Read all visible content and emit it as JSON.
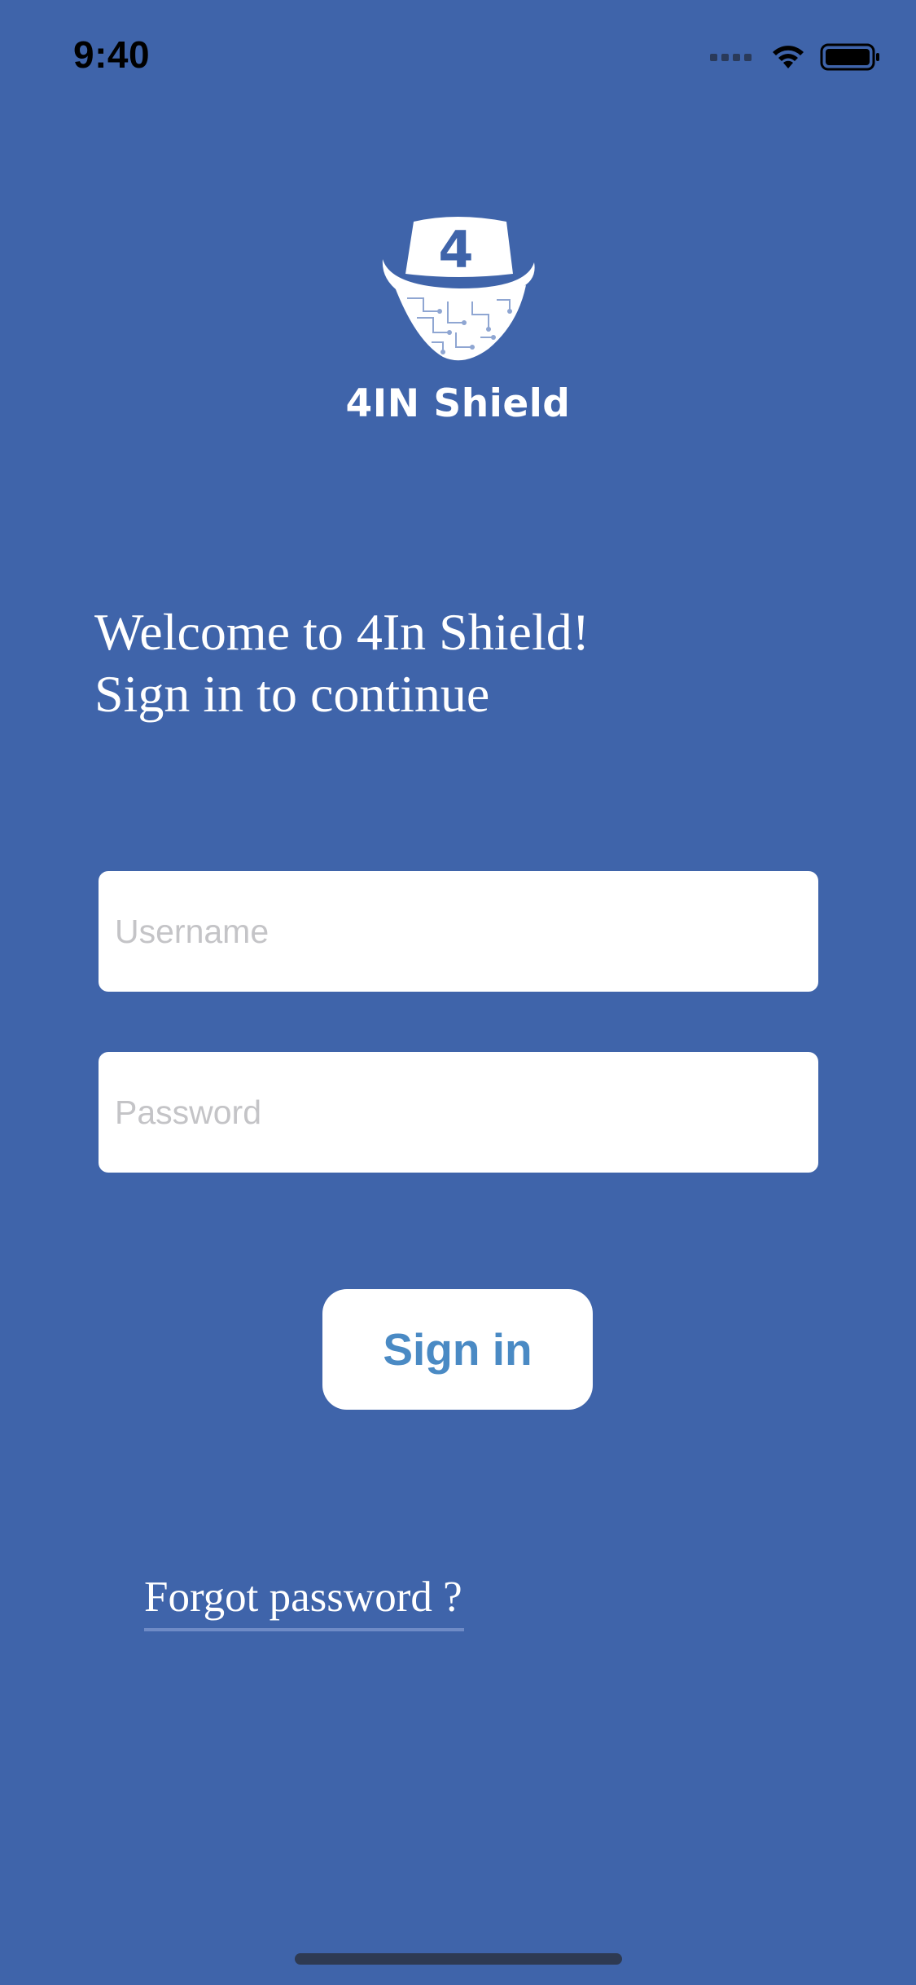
{
  "status_bar": {
    "time": "9:40",
    "icons": [
      "cellular-signal-icon",
      "wifi-icon",
      "battery-icon"
    ]
  },
  "brand": {
    "logo_icon": "hat-shield-logo-icon",
    "logo_digit": "4",
    "name": "4IN Shield"
  },
  "welcome": {
    "line1": "Welcome to 4In Shield!",
    "line2": "Sign in to continue"
  },
  "form": {
    "username_placeholder": "Username",
    "password_placeholder": "Password",
    "signin_label": "Sign in",
    "forgot_label": "Forgot password ?"
  },
  "colors": {
    "background": "#3f64aa",
    "button_text": "#4a8ac4",
    "placeholder": "#c4c4c7"
  }
}
